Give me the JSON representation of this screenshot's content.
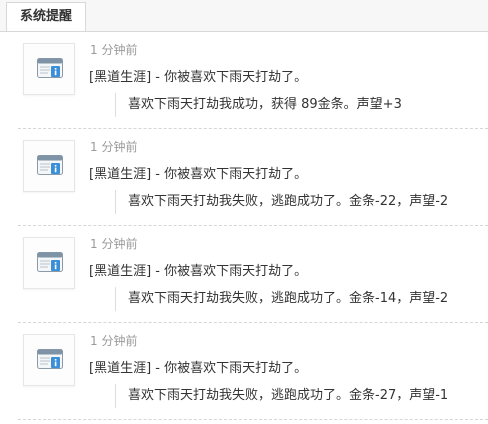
{
  "tab": {
    "label": "系统提醒"
  },
  "icon": "system-notice-icon",
  "notifications": [
    {
      "time": "1 分钟前",
      "title": "[黑道生涯] - 你被喜欢下雨天打劫了。",
      "detail": "喜欢下雨天打劫我成功，获得 89金条。声望+3"
    },
    {
      "time": "1 分钟前",
      "title": "[黑道生涯] - 你被喜欢下雨天打劫了。",
      "detail": "喜欢下雨天打劫我失败，逃跑成功了。金条-22，声望-2"
    },
    {
      "time": "1 分钟前",
      "title": "[黑道生涯] - 你被喜欢下雨天打劫了。",
      "detail": "喜欢下雨天打劫我失败，逃跑成功了。金条-14，声望-2"
    },
    {
      "time": "1 分钟前",
      "title": "[黑道生涯] - 你被喜欢下雨天打劫了。",
      "detail": "喜欢下雨天打劫我失败，逃跑成功了。金条-27，声望-1"
    }
  ]
}
